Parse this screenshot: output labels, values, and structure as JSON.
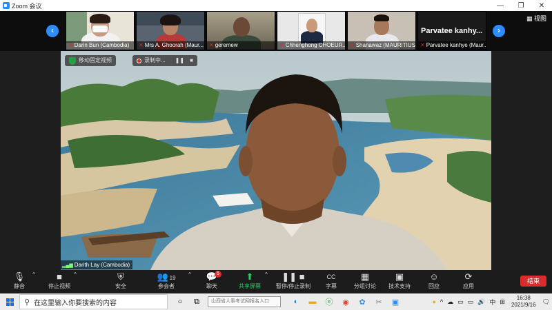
{
  "window": {
    "title": "Zoom 会议",
    "controls": [
      "—",
      "❐",
      "✕"
    ]
  },
  "thumbnails": {
    "view_label": "视图",
    "items": [
      {
        "name": "Darin Bun (Cambodia)"
      },
      {
        "name": "Mrs A. Ghoorah (Maur..."
      },
      {
        "name": "geremew"
      },
      {
        "name": "Chhenghong CHOEUR..."
      },
      {
        "name": "Shanawaz (MAURITIUS)"
      },
      {
        "name": "Parvatee kanhye (Maur...",
        "display_name": "Parvatee  kanhy..."
      }
    ]
  },
  "main_video": {
    "speaker": "Darith Lay (Cambodia)",
    "chip_label": "移动固定视频",
    "recording_label": "录制中..."
  },
  "toolbar": {
    "items": [
      {
        "label": "静音",
        "icon": "mic-icon"
      },
      {
        "label": "停止视频",
        "icon": "video-icon"
      },
      {
        "label": "安全",
        "icon": "shield-icon"
      },
      {
        "label": "参会者",
        "icon": "participants-icon",
        "count": "19"
      },
      {
        "label": "聊天",
        "icon": "chat-icon",
        "badge": "5"
      },
      {
        "label": "共享屏幕",
        "icon": "share-screen-icon"
      },
      {
        "label": "暂停/停止录制",
        "icon": "record-icon"
      },
      {
        "label": "字幕",
        "icon": "cc-icon"
      },
      {
        "label": "分组讨论",
        "icon": "breakout-icon"
      },
      {
        "label": "技术支持",
        "icon": "support-icon"
      },
      {
        "label": "回应",
        "icon": "reactions-icon"
      },
      {
        "label": "应用",
        "icon": "apps-icon"
      }
    ],
    "end_label": "结束"
  },
  "taskbar": {
    "search_placeholder": "在这里输入你要搜索的内容",
    "address_placeholder": "山西省人事考试网报名入口",
    "time": "16:38",
    "date": "2021/9/16",
    "ime": "中"
  },
  "colors": {
    "accent": "#2d8cff",
    "share_green": "#23d160",
    "end_red": "#d92c2c",
    "mute_red": "#e02828"
  }
}
